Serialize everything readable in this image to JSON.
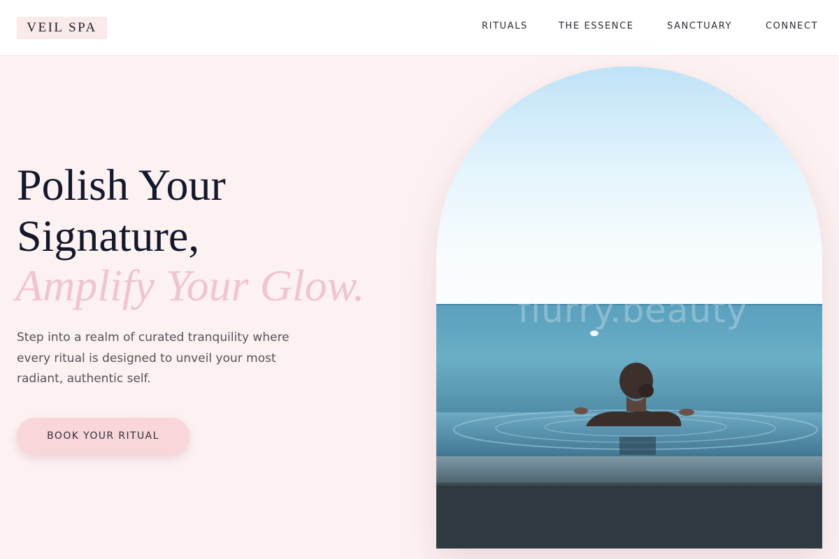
{
  "brand": {
    "name": "VEIL SPA"
  },
  "nav": {
    "items": [
      {
        "label": "RITUALS"
      },
      {
        "label": "THE ESSENCE"
      },
      {
        "label": "SANCTUARY"
      },
      {
        "label": "CONNECT"
      }
    ]
  },
  "hero": {
    "title": "Polish Your Signature,",
    "accent": "Amplify Your Glow.",
    "description": "Step into a realm of curated tranquility where every ritual is designed to unveil your most radiant, authentic self.",
    "cta_label": "BOOK YOUR RITUAL"
  },
  "image": {
    "watermark": "flurry.beauty"
  },
  "colors": {
    "background": "#fdf2f2",
    "accent_pink": "#f0c4d0",
    "button": "#f8d6da",
    "text_dark": "#13182b"
  }
}
